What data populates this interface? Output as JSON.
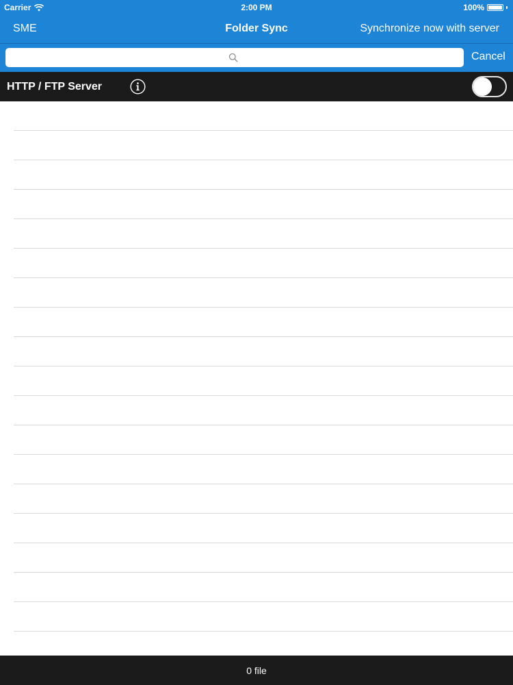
{
  "status_bar": {
    "carrier": "Carrier",
    "time": "2:00 PM",
    "battery": "100%"
  },
  "nav": {
    "left_label": "SME",
    "title": "Folder Sync",
    "right_label": "Synchronize now with server"
  },
  "search": {
    "value": "",
    "placeholder": "",
    "cancel_label": "Cancel"
  },
  "server": {
    "label": "HTTP / FTP Server",
    "toggle_on": false
  },
  "footer": {
    "file_count": "0 file"
  },
  "colors": {
    "header_blue": "#1e84d6",
    "dark_bar": "#1c1b1c",
    "separator": "#d9d9dd"
  }
}
